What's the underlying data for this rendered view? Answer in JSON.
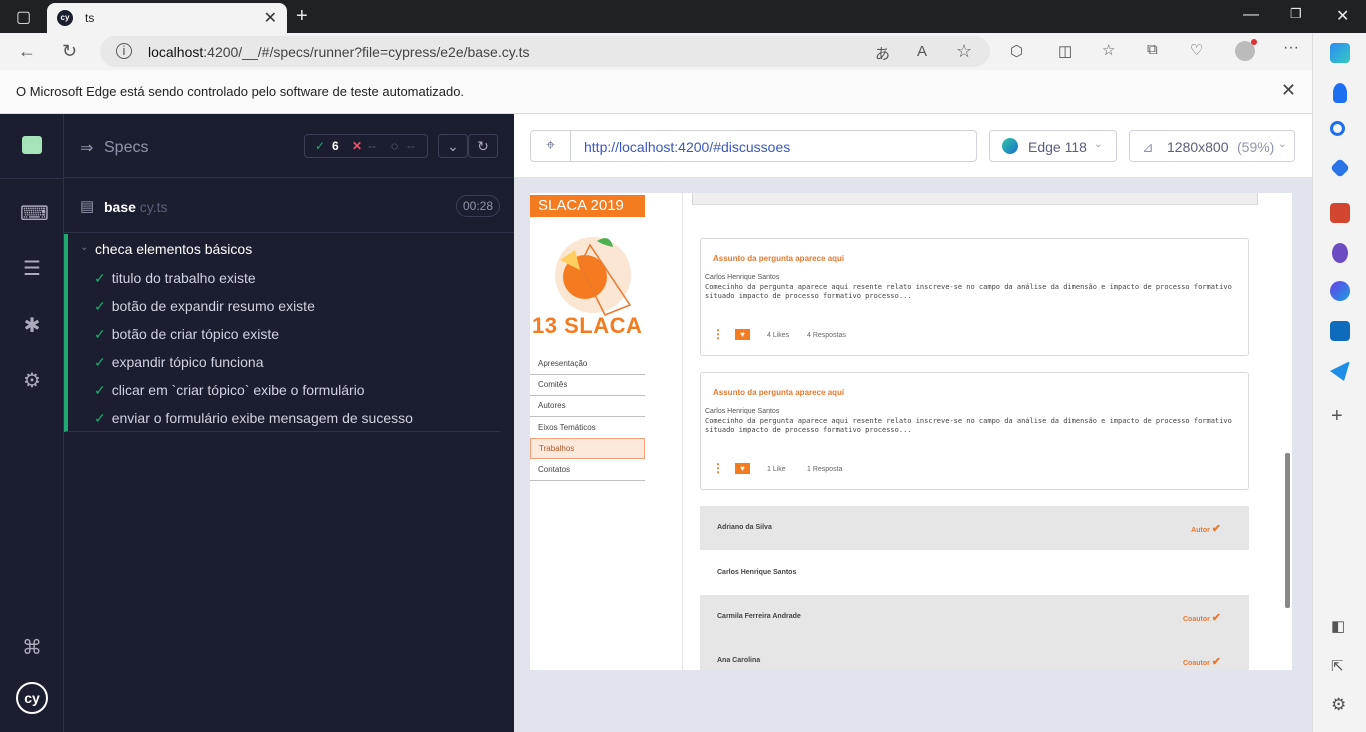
{
  "browser": {
    "tab_title": "ts",
    "tab_favicon": "cy",
    "url_host": "localhost",
    "url_rest": ":4200/__/#/specs/runner?file=cypress/e2e/base.cy.ts",
    "infobar_message": "O Microsoft Edge está sendo controlado pelo software de teste automatizado."
  },
  "specs_panel": {
    "header_label": "Specs",
    "passed_count": "6",
    "failed_count": "--",
    "pending_count": "--",
    "file_name": "base",
    "file_ext": " cy.ts",
    "duration": "00:28",
    "suite_title": "checa elementos básicos",
    "tests": [
      "titulo do trabalho existe",
      "botão de expandir resumo existe",
      "botão de criar tópico existe",
      "expandir tópico funciona",
      "clicar em `criar tópico` exibe o formulário",
      "enviar o formulário exibe mensagem de sucesso"
    ]
  },
  "runner": {
    "aut_url": "http://localhost:4200/#discussoes",
    "browser_name": "Edge 118",
    "viewport": "1280x800",
    "viewport_scale": "(59%)"
  },
  "app": {
    "badge": "SLACA 2019",
    "logo_text": "13 SLACA",
    "menu": [
      "Apresentação",
      "Comitês",
      "Autores",
      "Eixos Temáticos",
      "Trabalhos",
      "Contatos"
    ],
    "active_menu": "Trabalhos",
    "cards": [
      {
        "title": "Assunto da pergunta aparece aqui",
        "author": "Carlos Henrique Santos",
        "body": "Comecinho da pergunta aparece aqui resente relato inscreve-se no campo da análise da dimensão e impacto de processo formativo situado impacto de processo formativo processo...",
        "likes": "4 Likes",
        "responses": "4 Respostas"
      },
      {
        "title": "Assunto da pergunta aparece aqui",
        "author": "Carlos Henrique Santos",
        "body": "Comecinho da pergunta aparece aqui resente relato inscreve-se no campo da análise da dimensão e impacto de processo formativo situado impacto de processo formativo processo...",
        "likes": "1 Like",
        "responses": "1 Resposta"
      }
    ],
    "people": [
      {
        "name": "Adriano da Silva",
        "role": "Autor"
      },
      {
        "name": "Carlos Henrique Santos",
        "role": ""
      },
      {
        "name": "Carmila Ferreira Andrade",
        "role": "Coautor"
      },
      {
        "name": "Ana Carolina",
        "role": "Coautor"
      }
    ]
  },
  "colors": {
    "cypress_bg": "#1b1e2e",
    "pass_green": "#1fa971",
    "accent_orange": "#f47b20",
    "link_blue": "#3b57c4"
  }
}
